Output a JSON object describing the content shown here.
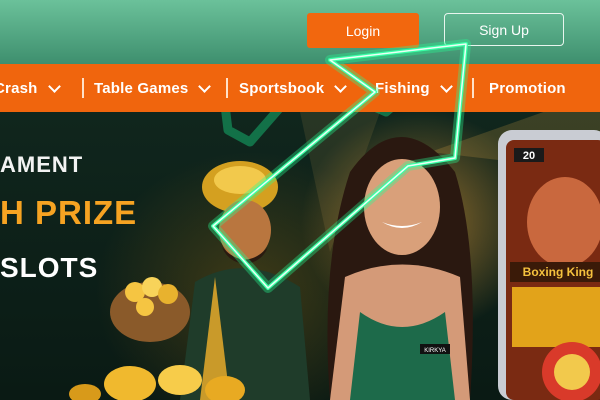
{
  "header": {
    "login_label": "Login",
    "signup_label": "Sign Up"
  },
  "nav": {
    "items": [
      {
        "label": "Crash",
        "has_dropdown": true
      },
      {
        "label": "Table Games",
        "has_dropdown": true
      },
      {
        "label": "Sportsbook",
        "has_dropdown": true
      },
      {
        "label": "Fishing",
        "has_dropdown": true
      },
      {
        "label": "Promotion",
        "has_dropdown": false
      }
    ]
  },
  "hero": {
    "line1": "AMENT",
    "line2": "H PRIZE",
    "line3": "SLOTS",
    "phone_game_title": "Boxing King",
    "phone_badge": "20",
    "model_badge": "KIRKYA"
  },
  "colors": {
    "header_green": "#4fa07c",
    "nav_orange": "#f0650d",
    "accent_gold": "#f6a322",
    "arrow_glow": "#3dffa0"
  },
  "icons": [
    "chevron-down-icon",
    "arrow-pointer-icon"
  ]
}
